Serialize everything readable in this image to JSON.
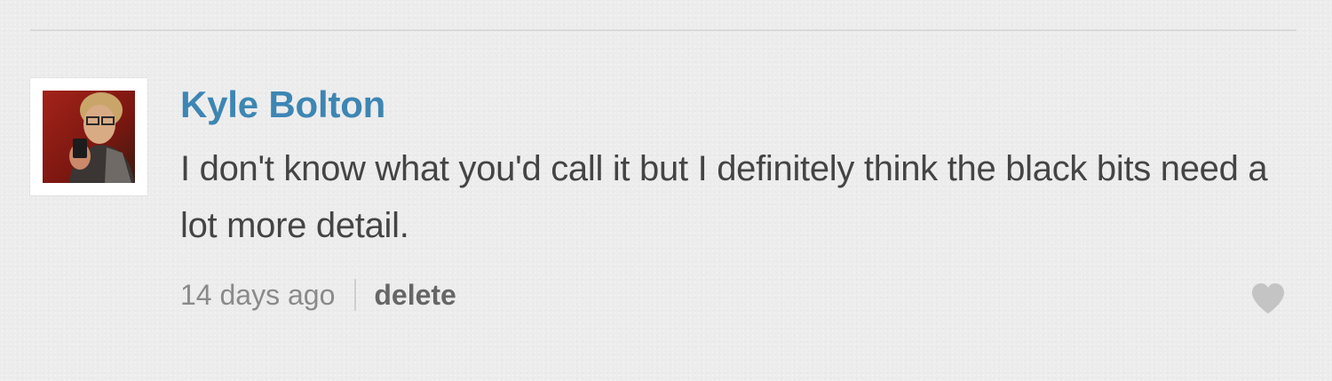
{
  "comment": {
    "author": "Kyle Bolton",
    "body": "I don't know what you'd call it but I definitely think the black bits need a lot more detail.",
    "timestamp": "14 days ago",
    "delete_label": "delete",
    "avatar_icon": "user-photo",
    "like_icon": "heart-icon"
  },
  "colors": {
    "author_link": "#3d86b3",
    "body_text": "#444444",
    "timestamp": "#8a8a8a",
    "delete_link": "#666666",
    "like_icon": "#c4c4c4",
    "background": "#ececec"
  }
}
